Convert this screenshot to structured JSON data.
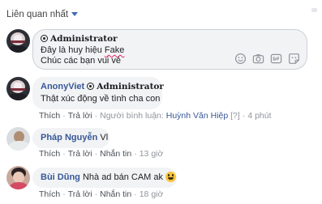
{
  "sort": {
    "label": "Liên quan nhất"
  },
  "composer": {
    "author": "Administrator",
    "line1": "Đây là huy hiệu",
    "line1_flagged": "Fake",
    "line2": "Chúc các bạn vui vẻ",
    "icons": [
      "emoji-icon",
      "camera-icon",
      "gif-icon",
      "sticker-icon"
    ]
  },
  "comments": [
    {
      "author": "AnonyViet",
      "badge": "Administrator",
      "text": "Thật xúc động về tình cha con",
      "actions": {
        "like": "Thích",
        "reply": "Trả lời",
        "by_label": "Người bình luận:",
        "by_name": "Huỳnh Văn Hiệp",
        "by_extra": "[?]",
        "time": "4 phút"
      }
    },
    {
      "author": "Pháp Nguyễn",
      "text": "Vl",
      "actions": {
        "like": "Thích",
        "reply": "Trả lời",
        "message": "Nhắn tin",
        "time": "13 giờ"
      }
    },
    {
      "author": "Bùi Dũng",
      "text": "Nhà ad bán CAM ak",
      "emoji": "grin-emoji",
      "actions": {
        "like": "Thích",
        "reply": "Trả lời",
        "message": "Nhắn tin",
        "time": "18 giờ"
      }
    }
  ]
}
